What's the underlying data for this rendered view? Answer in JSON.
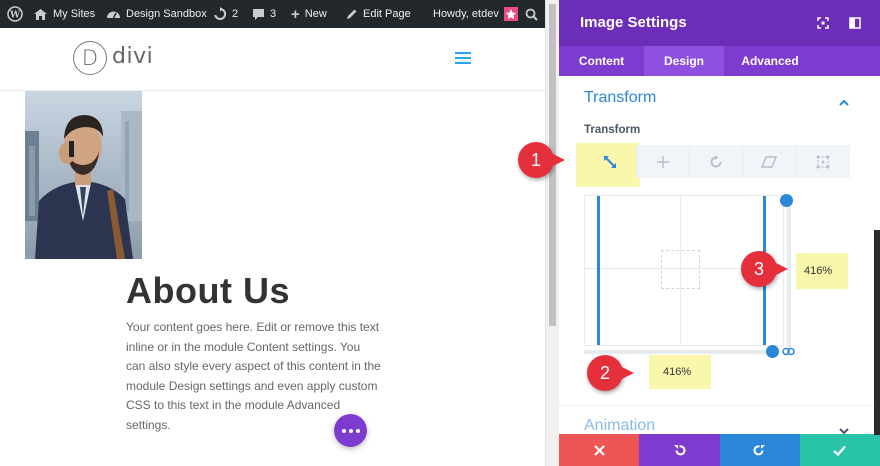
{
  "admin_bar": {
    "my_sites": "My Sites",
    "site_name": "Design Sandbox",
    "updates_count": "2",
    "comments_count": "3",
    "new_label": "New",
    "edit_page": "Edit Page",
    "howdy": "Howdy, etdev"
  },
  "site": {
    "logo_letter": "D",
    "logo_text": "divi"
  },
  "content": {
    "title": "About Us",
    "body": "Your content goes here. Edit or remove this text inline or in the module Content settings. You can also style every aspect of this content in the module Design settings and even apply custom CSS to this text in the module Advanced settings."
  },
  "panel": {
    "title": "Image Settings",
    "tabs": [
      {
        "label": "Content",
        "active": false
      },
      {
        "label": "Design",
        "active": true
      },
      {
        "label": "Advanced",
        "active": false
      }
    ],
    "section_title": "Transform",
    "field_label": "Transform",
    "transform_tools": [
      "scale-icon",
      "translate-icon",
      "rotate-icon",
      "skew-icon",
      "origin-icon"
    ],
    "scale_y_value": "416%",
    "scale_x_value": "416%",
    "next_section": "Animation"
  },
  "callouts": [
    "1",
    "2",
    "3"
  ],
  "colors": {
    "header_purple": "#6c2eb9",
    "tabs_purple": "#7e3bd0",
    "accent_blue": "#2b87da",
    "highlight": "#f8f7ab",
    "callout_red": "#e5303b",
    "cancel": "#ef5555",
    "undo": "#7e3bd0",
    "redo": "#2b87da",
    "save": "#29c4a9"
  }
}
